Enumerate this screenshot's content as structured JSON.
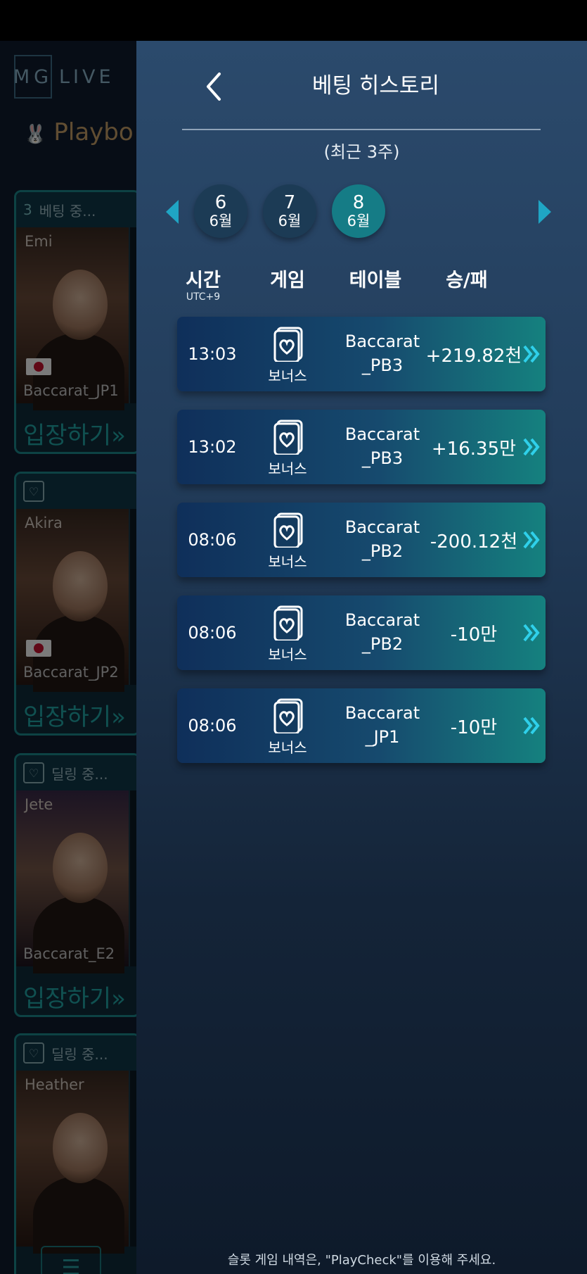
{
  "lobby": {
    "logo_mg": "MG",
    "logo_live": "LIVE",
    "brand": "Playbo",
    "cards": [
      {
        "num": "3",
        "status": "베팅 중...",
        "dealer": "Emi",
        "table": "Baccarat_JP1",
        "enter": "입장하기»"
      },
      {
        "num": "",
        "status": "",
        "dealer": "Akira",
        "table": "Baccarat_JP2",
        "enter": "입장하기»"
      },
      {
        "num": "",
        "status": "딜링 중...",
        "dealer": "Jete",
        "table": "Baccarat_E2",
        "enter": "입장하기»"
      },
      {
        "num": "",
        "status": "딜링 중...",
        "dealer": "Heather",
        "table": "",
        "enter": ""
      }
    ]
  },
  "panel": {
    "title": "베팅 히스토리",
    "range_note": "(최근 3주)",
    "dates": [
      {
        "day": "6",
        "month": "6월",
        "active": false
      },
      {
        "day": "7",
        "month": "6월",
        "active": false
      },
      {
        "day": "8",
        "month": "6월",
        "active": true
      }
    ],
    "columns": {
      "time": "시간",
      "time_sub": "UTC+9",
      "game": "게임",
      "table": "테이블",
      "result": "승/패"
    },
    "rows": [
      {
        "time": "13:03",
        "game": "보너스",
        "table_line1": "Baccarat",
        "table_line2": "_PB3",
        "result": "+219.82천"
      },
      {
        "time": "13:02",
        "game": "보너스",
        "table_line1": "Baccarat",
        "table_line2": "_PB3",
        "result": "+16.35만"
      },
      {
        "time": "08:06",
        "game": "보너스",
        "table_line1": "Baccarat",
        "table_line2": "_PB2",
        "result": "-200.12천"
      },
      {
        "time": "08:06",
        "game": "보너스",
        "table_line1": "Baccarat",
        "table_line2": "_PB2",
        "result": "-10만"
      },
      {
        "time": "08:06",
        "game": "보너스",
        "table_line1": "Baccarat",
        "table_line2": "_JP1",
        "result": "-10만"
      }
    ],
    "footer_note": "슬롯 게임 내역은, \"PlayCheck\"를 이용해 주세요."
  },
  "colors": {
    "accent": "#1fa5c4",
    "active_date": "#157c86",
    "row_start": "#0f2f5a",
    "row_end": "#15817f"
  }
}
